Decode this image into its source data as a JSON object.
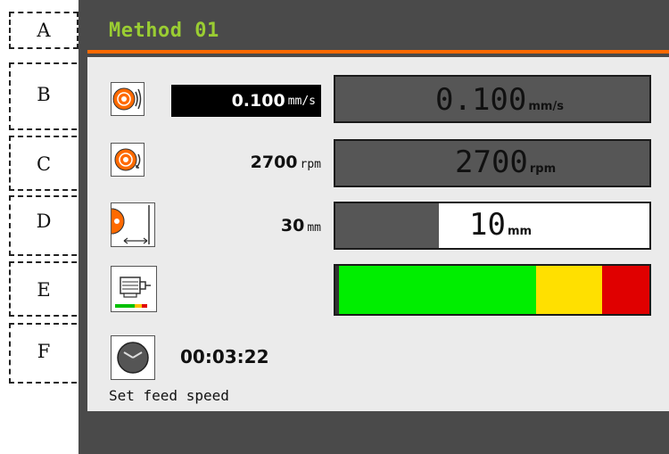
{
  "title": "Method 01",
  "callouts": [
    "A",
    "B",
    "C",
    "D",
    "E",
    "F"
  ],
  "feed_speed": {
    "icon": "disc-feed-icon",
    "setpoint": "0.100",
    "setpoint_unit": "mm/s",
    "actual": "0.100",
    "actual_unit": "mm/s"
  },
  "rotation": {
    "icon": "disc-rotation-icon",
    "setpoint": "2700",
    "setpoint_unit": "rpm",
    "actual": "2700",
    "actual_unit": "rpm"
  },
  "removal": {
    "icon": "disc-distance-icon",
    "setpoint": "30",
    "setpoint_unit": "mm",
    "actual": "10",
    "actual_unit": "mm",
    "progress_fraction": 0.33
  },
  "load": {
    "icon": "motor-load-icon",
    "level_fraction": 0.01
  },
  "time": {
    "icon": "clock-icon",
    "value": "00:03:22"
  },
  "status_text": "Set feed speed",
  "colors": {
    "title": "#9acd32",
    "accent": "#ff6a00",
    "load_green": "#00ee00",
    "load_yellow": "#ffe000",
    "load_red": "#e00000"
  }
}
